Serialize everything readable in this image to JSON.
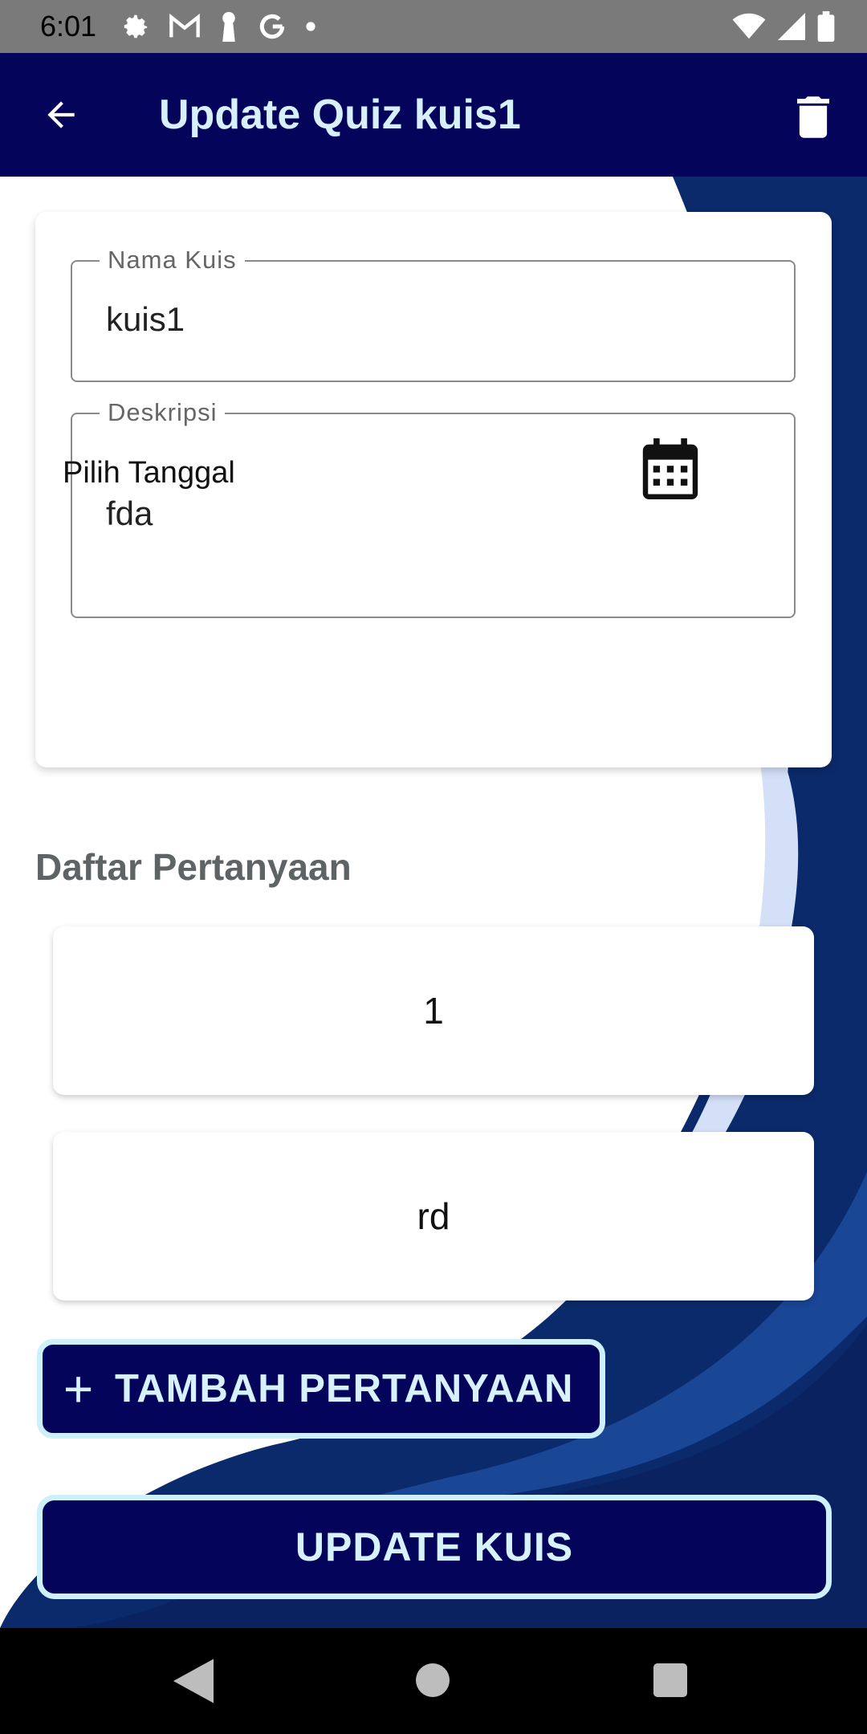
{
  "status_bar": {
    "time": "6:01"
  },
  "app_bar": {
    "title": "Update Quiz kuis1"
  },
  "form": {
    "name_label": "Nama Kuis",
    "name_value": "kuis1",
    "description_label": "Deskripsi",
    "description_value": "fda",
    "date_label": "Pilih Tanggal"
  },
  "questions": {
    "title": "Daftar Pertanyaan",
    "items": [
      {
        "label": "1"
      },
      {
        "label": "rd"
      }
    ]
  },
  "actions": {
    "add_label": "TAMBAH PERTANYAAN",
    "update_label": "UPDATE KUIS"
  },
  "colors": {
    "app_bar": "#04045a",
    "title_text": "#d8effc",
    "button_border": "#cdf0fb",
    "background_wave": "#0b2a6b"
  }
}
